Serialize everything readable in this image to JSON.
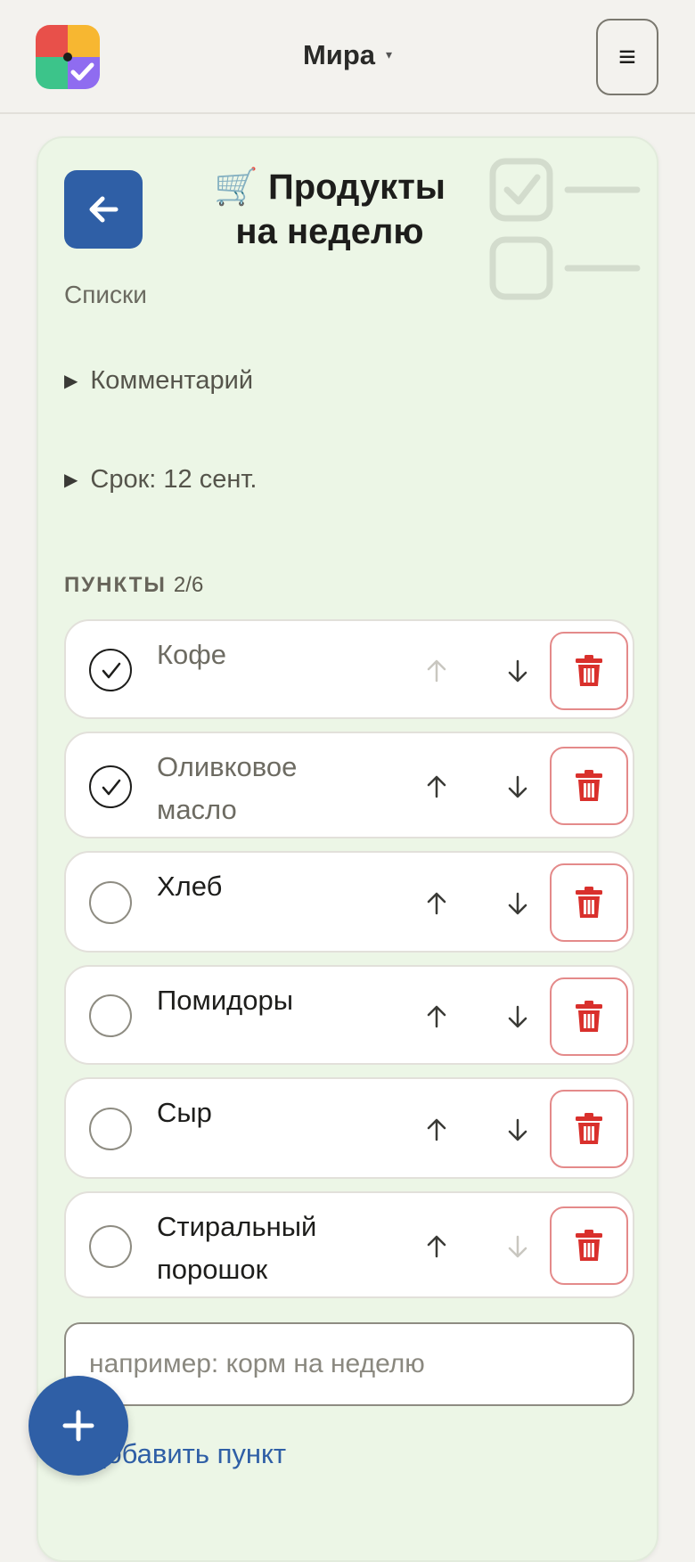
{
  "header": {
    "profile_name": "Мира",
    "profile_caret": "▾",
    "menu_glyph": "≡"
  },
  "list": {
    "title_emoji": "🛒",
    "title_line1": "Продукты",
    "title_line2": "на неделю",
    "breadcrumb": "Списки",
    "comment_toggle": "Комментарий",
    "due_toggle": "Срок: 12 сент.",
    "section_label": "ПУНКТЫ",
    "section_count": "2/6"
  },
  "items": [
    {
      "line1": "Кофе",
      "line2": "",
      "checked": true
    },
    {
      "line1": "Оливковое",
      "line2": "масло",
      "checked": true
    },
    {
      "line1": "Хлеб",
      "line2": "",
      "checked": false
    },
    {
      "line1": "Помидоры",
      "line2": "",
      "checked": false
    },
    {
      "line1": "Сыр",
      "line2": "",
      "checked": false
    },
    {
      "line1": "Стиральный",
      "line2": "порошок",
      "checked": false
    }
  ],
  "new_item": {
    "placeholder": "например: корм на неделю",
    "add_label": "Добавить пункт"
  },
  "colors": {
    "accent": "#2f5fa6",
    "card_bg": "#ecf6e6",
    "delete_red": "#d9302c"
  },
  "icons": {
    "back": "arrow-left-icon",
    "move_up": "arrow-up-icon",
    "move_down": "arrow-down-icon",
    "delete": "trash-icon",
    "fab": "plus-icon"
  }
}
